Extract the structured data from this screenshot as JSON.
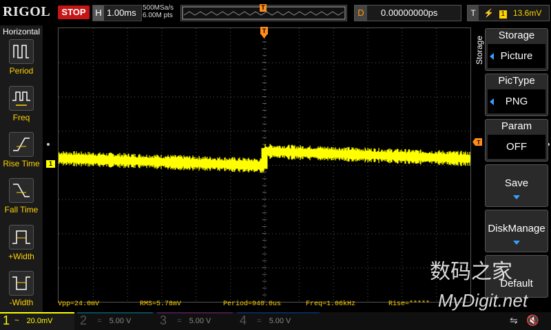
{
  "header": {
    "logo": "RIGOL",
    "run_state": "STOP",
    "timebase_label": "H",
    "timebase_value": "1.00ms",
    "sample_rate": "500MSa/s",
    "memory_depth": "6.00M pts",
    "trigger_marker": "T",
    "delay_label": "D",
    "delay_value": "0.00000000ps",
    "trigger_label": "T",
    "trigger_source": "1",
    "trigger_level": "13.6mV",
    "trigger_slope_icon": "rising-edge-icon"
  },
  "left_panel": {
    "title": "Horizontal",
    "items": [
      {
        "label": "Period",
        "icon": "period-icon"
      },
      {
        "label": "Freq",
        "icon": "freq-icon"
      },
      {
        "label": "Rise Time",
        "icon": "rise-time-icon"
      },
      {
        "label": "Fall Time",
        "icon": "fall-time-icon"
      },
      {
        "label": "+Width",
        "icon": "positive-width-icon"
      },
      {
        "label": "-Width",
        "icon": "negative-width-icon"
      }
    ]
  },
  "right_menu": {
    "tab": "Storage",
    "buttons": [
      {
        "title": "Storage",
        "value": "Picture"
      },
      {
        "title": "PicType",
        "value": "PNG"
      },
      {
        "title": "Param",
        "value": "OFF"
      },
      {
        "title": "Save",
        "value": ""
      },
      {
        "title": "DiskManage",
        "value": ""
      },
      {
        "title": "Default",
        "value": ""
      }
    ]
  },
  "waveform": {
    "channel_marker": "1",
    "trigger_level_marker": "T",
    "color": "#ffff00"
  },
  "measurements": {
    "vpp": "Vpp=24.0mV",
    "rms": "RMS=5.78mV",
    "period": "Period=940.0us",
    "freq": "Freq=1.06kHz",
    "rise": "Rise=*****"
  },
  "channels": [
    {
      "num": "1",
      "coupling": "~",
      "scale": "20.0mV",
      "color": "#ffff00",
      "active": true
    },
    {
      "num": "2",
      "coupling": "=",
      "scale": "5.00 V",
      "color": "#00d0ff",
      "active": false
    },
    {
      "num": "3",
      "coupling": "=",
      "scale": "5.00 V",
      "color": "#ff3fd0",
      "active": false
    },
    {
      "num": "4",
      "coupling": "=",
      "scale": "5.00 V",
      "color": "#1a7fff",
      "active": false
    }
  ],
  "status_icons": [
    "usb-icon",
    "speaker-muted-icon"
  ],
  "watermark": {
    "line1": "数码之家",
    "line2": "MyDigit.net"
  }
}
